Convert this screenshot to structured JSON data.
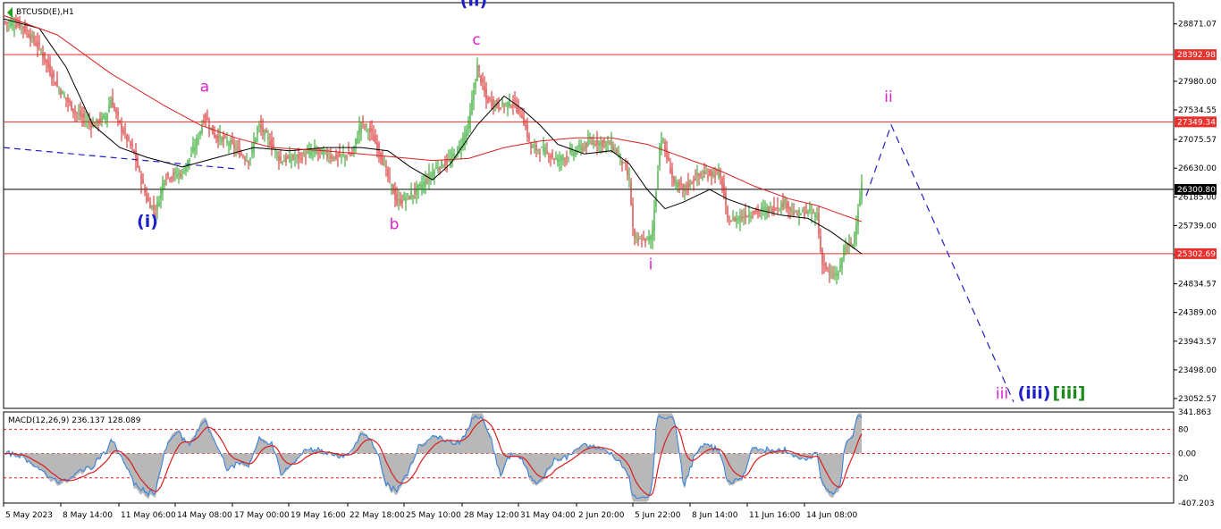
{
  "chart_data": {
    "type": "candlestick",
    "title": "BTCUSD(E),H1",
    "price_axis": {
      "ylim": [
        22900,
        29200
      ],
      "ticks": [
        "28871.07",
        "27980.00",
        "27534.55",
        "27075.57",
        "26630.00",
        "26185.00",
        "25739.00",
        "25284.57",
        "24834.57",
        "24389.00",
        "23943.57",
        "23498.00",
        "23052.57"
      ]
    },
    "time_axis": {
      "labels": [
        "5 May 2023",
        "8 May 14:00",
        "11 May 06:00",
        "14 May 08:00",
        "17 May 00:00",
        "19 May 16:00",
        "22 May 18:00",
        "25 May 10:00",
        "28 May 12:00",
        "31 May 04:00",
        "2 Jun 20:00",
        "5 Jun 22:00",
        "8 Jun 14:00",
        "11 Jun 16:00",
        "14 Jun 08:00"
      ]
    },
    "levels": [
      {
        "value": 28392.98,
        "label": "28392.98",
        "color": "#e8302c"
      },
      {
        "value": 27349.34,
        "label": "27349.34",
        "color": "#e8302c"
      },
      {
        "value": 26300.8,
        "label": "26300.80",
        "color": "#000000"
      },
      {
        "value": 25302.69,
        "label": "25302.69",
        "color": "#e8302c"
      }
    ],
    "price_path": [
      [
        0,
        28900
      ],
      [
        20,
        28850
      ],
      [
        40,
        28500
      ],
      [
        60,
        27900
      ],
      [
        80,
        27500
      ],
      [
        100,
        27300
      ],
      [
        115,
        27450
      ],
      [
        120,
        27700
      ],
      [
        130,
        27300
      ],
      [
        145,
        26900
      ],
      [
        160,
        26150
      ],
      [
        170,
        25950
      ],
      [
        180,
        26500
      ],
      [
        200,
        26550
      ],
      [
        215,
        27000
      ],
      [
        225,
        27450
      ],
      [
        235,
        27150
      ],
      [
        255,
        27000
      ],
      [
        265,
        26850
      ],
      [
        275,
        26750
      ],
      [
        285,
        27300
      ],
      [
        300,
        27000
      ],
      [
        310,
        26750
      ],
      [
        330,
        26800
      ],
      [
        350,
        26900
      ],
      [
        370,
        26800
      ],
      [
        390,
        26850
      ],
      [
        400,
        27350
      ],
      [
        410,
        27200
      ],
      [
        420,
        26900
      ],
      [
        430,
        26500
      ],
      [
        440,
        26100
      ],
      [
        455,
        26200
      ],
      [
        470,
        26400
      ],
      [
        485,
        26650
      ],
      [
        500,
        26750
      ],
      [
        510,
        26950
      ],
      [
        520,
        27300
      ],
      [
        530,
        28200
      ],
      [
        540,
        27700
      ],
      [
        555,
        27600
      ],
      [
        570,
        27650
      ],
      [
        580,
        27450
      ],
      [
        590,
        26950
      ],
      [
        605,
        26900
      ],
      [
        620,
        26750
      ],
      [
        640,
        26900
      ],
      [
        660,
        27050
      ],
      [
        680,
        27000
      ],
      [
        690,
        26800
      ],
      [
        700,
        26450
      ],
      [
        705,
        25500
      ],
      [
        715,
        25500
      ],
      [
        725,
        25550
      ],
      [
        730,
        26300
      ],
      [
        735,
        27150
      ],
      [
        740,
        26900
      ],
      [
        750,
        26400
      ],
      [
        760,
        26300
      ],
      [
        775,
        26500
      ],
      [
        790,
        26550
      ],
      [
        800,
        26550
      ],
      [
        805,
        26300
      ],
      [
        810,
        25800
      ],
      [
        820,
        25850
      ],
      [
        840,
        25950
      ],
      [
        860,
        26000
      ],
      [
        875,
        26100
      ],
      [
        885,
        25900
      ],
      [
        900,
        25950
      ],
      [
        910,
        25900
      ],
      [
        915,
        25200
      ],
      [
        925,
        24950
      ],
      [
        935,
        25000
      ],
      [
        940,
        25400
      ],
      [
        950,
        25450
      ],
      [
        955,
        25900
      ],
      [
        960,
        26380
      ]
    ],
    "moving_averages": [
      {
        "color": "#000000",
        "points": [
          [
            0,
            28950
          ],
          [
            40,
            28800
          ],
          [
            70,
            28200
          ],
          [
            100,
            27300
          ],
          [
            130,
            26950
          ],
          [
            160,
            26800
          ],
          [
            200,
            26650
          ],
          [
            240,
            26800
          ],
          [
            280,
            26950
          ],
          [
            320,
            26900
          ],
          [
            360,
            26950
          ],
          [
            400,
            26950
          ],
          [
            430,
            26900
          ],
          [
            455,
            26650
          ],
          [
            480,
            26450
          ],
          [
            500,
            26700
          ],
          [
            530,
            27300
          ],
          [
            560,
            27750
          ],
          [
            580,
            27550
          ],
          [
            600,
            27300
          ],
          [
            620,
            27000
          ],
          [
            650,
            26850
          ],
          [
            680,
            26900
          ],
          [
            700,
            26700
          ],
          [
            720,
            26300
          ],
          [
            740,
            26000
          ],
          [
            760,
            26100
          ],
          [
            790,
            26300
          ],
          [
            810,
            26150
          ],
          [
            840,
            26000
          ],
          [
            870,
            25900
          ],
          [
            900,
            25850
          ],
          [
            925,
            25650
          ],
          [
            945,
            25450
          ],
          [
            960,
            25300
          ]
        ]
      },
      {
        "color": "#d82020",
        "points": [
          [
            0,
            29000
          ],
          [
            60,
            28700
          ],
          [
            120,
            28100
          ],
          [
            180,
            27600
          ],
          [
            220,
            27300
          ],
          [
            260,
            27100
          ],
          [
            300,
            26950
          ],
          [
            360,
            26900
          ],
          [
            400,
            26850
          ],
          [
            440,
            26800
          ],
          [
            480,
            26750
          ],
          [
            520,
            26780
          ],
          [
            560,
            26950
          ],
          [
            600,
            27050
          ],
          [
            640,
            27100
          ],
          [
            680,
            27100
          ],
          [
            720,
            27000
          ],
          [
            760,
            26800
          ],
          [
            800,
            26600
          ],
          [
            840,
            26350
          ],
          [
            880,
            26150
          ],
          [
            910,
            26050
          ],
          [
            930,
            25950
          ],
          [
            960,
            25800
          ]
        ]
      }
    ],
    "projection": [
      [
        965,
        26200
      ],
      [
        993,
        27300
      ],
      [
        1130,
        23000
      ]
    ],
    "trendline_dashed": [
      [
        0,
        26950
      ],
      [
        260,
        26620
      ]
    ],
    "wave_labels": [
      {
        "text": "(ii)",
        "value": 29150,
        "color": "#1e1ec8",
        "bold": true
      },
      {
        "text": "c",
        "value": 28550,
        "color": "#e020d0"
      },
      {
        "text": "a",
        "value": 27820,
        "color": "#e020d0"
      },
      {
        "text": "ii",
        "value": 27660,
        "color": "#e020d0"
      },
      {
        "text": "(i)",
        "value": 25720,
        "color": "#1e1ec8",
        "bold": true
      },
      {
        "text": "b",
        "value": 25680,
        "color": "#e020d0"
      },
      {
        "text": "i",
        "value": 25060,
        "color": "#e020d0"
      },
      {
        "text": "iii",
        "value": 23050,
        "color": "#e020d0"
      },
      {
        "text": "(iii)",
        "value": 23050,
        "color": "#1e1ec8",
        "bold": true
      },
      {
        "text": "[iii]",
        "value": 23050,
        "color": "#1a8a1a",
        "bold": true
      }
    ],
    "indicator": {
      "title": "MACD(12,26,9) 236.137 128.089",
      "ylim": [
        -407.203,
        341.863
      ],
      "ticks": [
        "341.863",
        "80",
        "0.00",
        "20",
        "-407.203"
      ],
      "levels": [
        200,
        0,
        -200
      ]
    }
  }
}
